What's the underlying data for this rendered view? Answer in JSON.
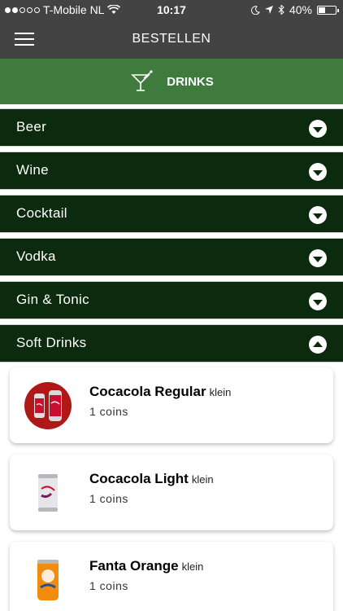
{
  "status_bar": {
    "carrier": "T-Mobile NL",
    "time": "10:17",
    "battery": "40%",
    "battery_level": 0.4
  },
  "nav": {
    "title": "BESTELLEN",
    "menu_icon": "hamburger-menu-icon"
  },
  "section": {
    "title": "DRINKS",
    "icon": "cocktail-glass-icon",
    "color": "#3f7b3c"
  },
  "categories": [
    {
      "label": "Beer",
      "expanded": false
    },
    {
      "label": "Wine",
      "expanded": false
    },
    {
      "label": "Cocktail",
      "expanded": false
    },
    {
      "label": "Vodka",
      "expanded": false
    },
    {
      "label": "Gin & Tonic",
      "expanded": false
    },
    {
      "label": "Soft Drinks",
      "expanded": true
    }
  ],
  "products": [
    {
      "name": "Cocacola Regular",
      "size": "klein",
      "price": "1 coins",
      "image": "coca-cola-can-icon"
    },
    {
      "name": "Cocacola Light",
      "size": "klein",
      "price": "1 coins",
      "image": "coca-cola-light-can-icon"
    },
    {
      "name": "Fanta Orange",
      "size": "klein",
      "price": "1 coins",
      "image": "fanta-can-icon"
    }
  ],
  "colors": {
    "bar_background": "#434343",
    "category_background": "#0b2a0e"
  }
}
